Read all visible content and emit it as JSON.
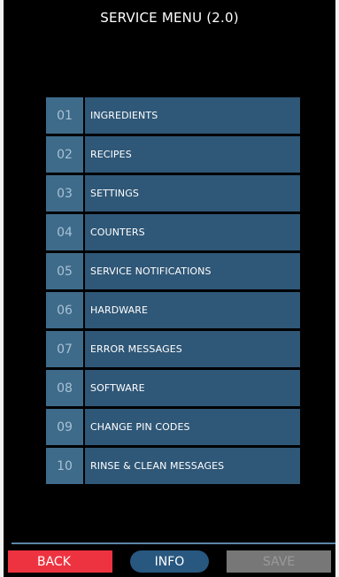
{
  "header": {
    "title": "SERVICE MENU (2.0)"
  },
  "menu": {
    "items": [
      {
        "number": "01",
        "label": "INGREDIENTS"
      },
      {
        "number": "02",
        "label": "RECIPES"
      },
      {
        "number": "03",
        "label": "SETTINGS"
      },
      {
        "number": "04",
        "label": "COUNTERS"
      },
      {
        "number": "05",
        "label": "SERVICE NOTIFICATIONS"
      },
      {
        "number": "06",
        "label": "HARDWARE"
      },
      {
        "number": "07",
        "label": "ERROR MESSAGES"
      },
      {
        "number": "08",
        "label": "SOFTWARE"
      },
      {
        "number": "09",
        "label": "CHANGE PIN CODES"
      },
      {
        "number": "10",
        "label": "RINSE & CLEAN MESSAGES"
      }
    ]
  },
  "footer": {
    "back_label": "BACK",
    "info_label": "INFO",
    "save_label": "SAVE"
  },
  "colors": {
    "background": "#000000",
    "menu_number_bg": "#3e6b8a",
    "menu_label_bg": "#2f5777",
    "back_button": "#ee3340",
    "info_button": "#28577f",
    "save_button_disabled": "#777777",
    "divider": "#5c86a8"
  }
}
